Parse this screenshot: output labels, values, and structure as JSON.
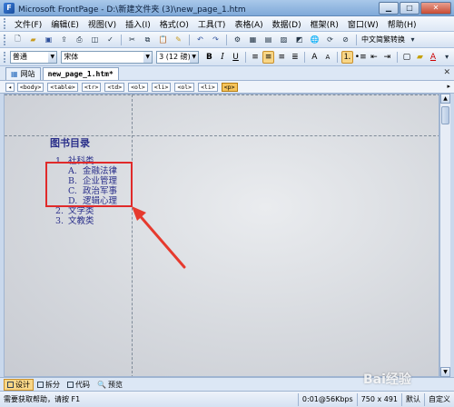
{
  "window": {
    "title": "Microsoft FrontPage - D:\\新建文件夹 (3)\\new_page_1.htm"
  },
  "menu": [
    "文件(F)",
    "编辑(E)",
    "视图(V)",
    "插入(I)",
    "格式(O)",
    "工具(T)",
    "表格(A)",
    "数据(D)",
    "框架(R)",
    "窗口(W)",
    "帮助(H)"
  ],
  "toolbar": {
    "language_label": "中文简繁转换"
  },
  "format": {
    "style": "普通",
    "font": "宋体",
    "size": "3 (12 磅)"
  },
  "tabs": {
    "site": "网站",
    "page": "new_page_1.htm*"
  },
  "tags": [
    "<body>",
    "<table>",
    "<tr>",
    "<td>",
    "<ol>",
    "<li>",
    "<ol>",
    "<li>",
    "<p>"
  ],
  "content": {
    "heading": "图书目录",
    "items": [
      {
        "num": "1.",
        "label": "社科类",
        "sub": [
          {
            "num": "A.",
            "label": "金融法律"
          },
          {
            "num": "B.",
            "label": "企业管理"
          },
          {
            "num": "C.",
            "label": "政治军事"
          },
          {
            "num": "D.",
            "label": "逻辑心理"
          }
        ]
      },
      {
        "num": "2.",
        "label": "文学类"
      },
      {
        "num": "3.",
        "label": "文教类"
      }
    ]
  },
  "views": {
    "design": "设计",
    "split": "拆分",
    "code": "代码",
    "preview": "预览"
  },
  "status": {
    "help": "需要获取帮助，请按 F1",
    "speed": "0:01@56Kbps",
    "size": "750 x 491",
    "mode": "默认",
    "custom": "自定义"
  },
  "watermark": "Bai经验"
}
